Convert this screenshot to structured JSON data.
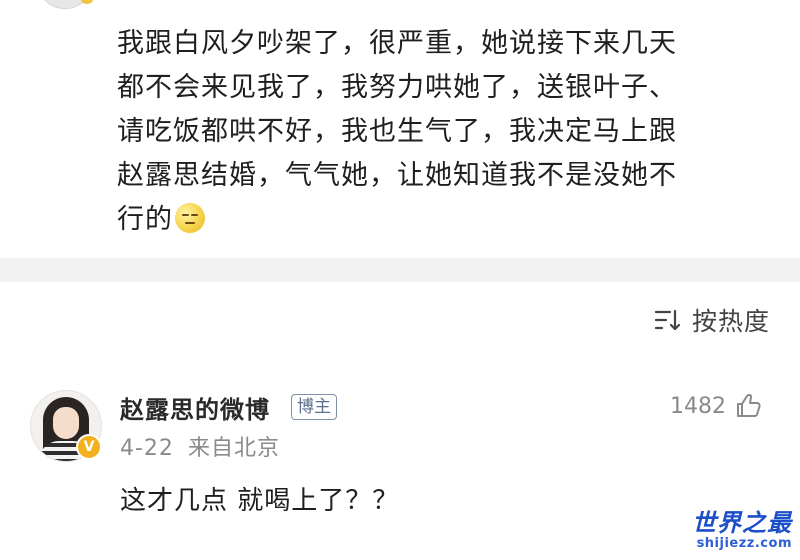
{
  "post": {
    "text": "我跟白风夕吵架了，很严重，她说接下来几天\n都不会来见我了，我努力哄她了，送银叶子、\n请吃饭都哄不好，我也生气了，我决定马上跟\n赵露思结婚，气气她，让她知道我不是没她不\n行的",
    "emoji_icon": "grimace-emoji-icon"
  },
  "sort": {
    "label": "按热度",
    "icon": "sort-lines-icon"
  },
  "comment": {
    "author": "赵露思的微博",
    "role_tag": "博主",
    "verified_icon": "verified-v-icon",
    "date": "4-22",
    "location": "来自北京",
    "like_count": "1482",
    "like_icon": "thumbs-up-icon",
    "text": "这才几点 就喝上了？？"
  },
  "watermark": {
    "title": "世界之最",
    "url": "shijiezz.com"
  },
  "colors": {
    "tag_border": "#7e8fa8",
    "verified_badge": "#f2b01e",
    "watermark_blue": "#1c4fc9",
    "separator": "#f2f2f2"
  }
}
